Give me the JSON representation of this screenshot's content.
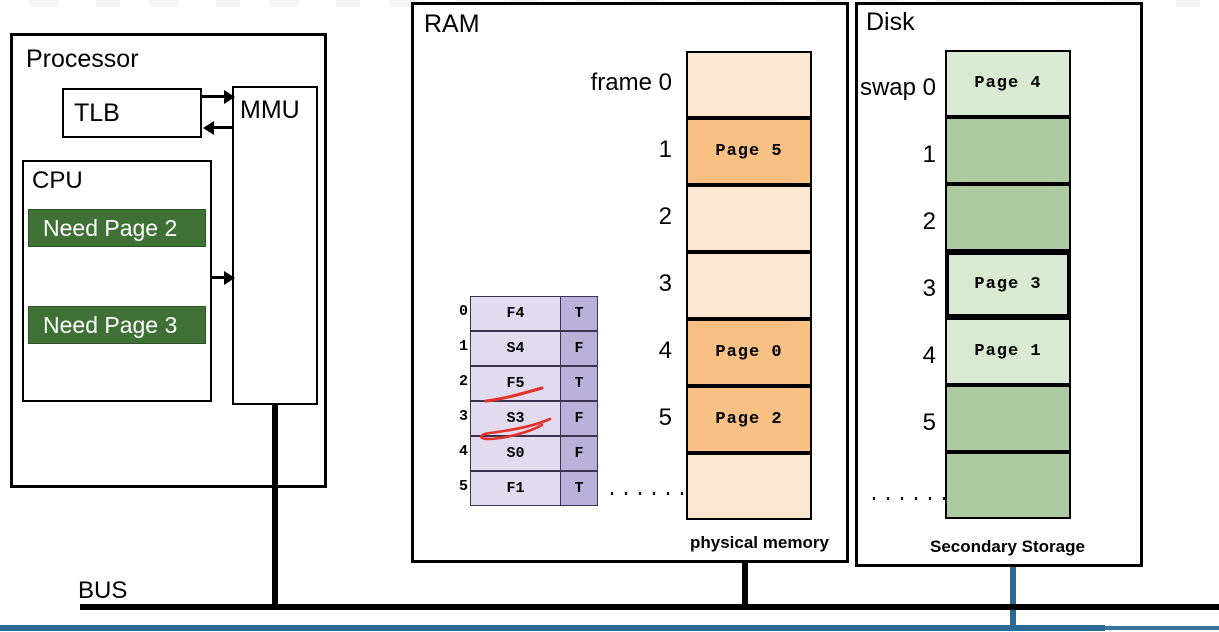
{
  "diagram": {
    "title_hidden_top_strip": "",
    "processor": {
      "label": "Processor",
      "tlb_label": "TLB",
      "mmu_label": "MMU",
      "cpu_label": "CPU",
      "requests": [
        "Need Page 2",
        "Need Page 3"
      ],
      "request_color": "#3f7036"
    },
    "ram": {
      "label": "RAM",
      "caption": "physical memory",
      "frame_label_prefix": "frame",
      "frame_labels": [
        "frame 0",
        "1",
        "2",
        "3",
        "4",
        "5"
      ],
      "ellipsis": "......",
      "frames": [
        {
          "index": "0",
          "content": "",
          "occupied": false
        },
        {
          "index": "1",
          "content": "Page  5",
          "occupied": true
        },
        {
          "index": "2",
          "content": "",
          "occupied": false
        },
        {
          "index": "3",
          "content": "",
          "occupied": false
        },
        {
          "index": "4",
          "content": "Page  0",
          "occupied": true
        },
        {
          "index": "5",
          "content": "Page  2",
          "occupied": true
        },
        {
          "index": "",
          "content": "",
          "occupied": false
        }
      ],
      "frame_empty_color": "#fce6cf",
      "frame_used_color": "#f8c183",
      "page_table": {
        "indices": [
          "0",
          "1",
          "2",
          "3",
          "4",
          "5"
        ],
        "location": [
          "F4",
          "S4",
          "F5",
          "S3",
          "S0",
          "F1"
        ],
        "valid": [
          "T",
          "F",
          "T",
          "F",
          "F",
          "T"
        ],
        "annotated_rows": [
          "2",
          "3"
        ],
        "annotation_color": "#e8302a",
        "col_value_color": "#e2dbf0",
        "col_flag_color": "#b9b1d9"
      }
    },
    "disk": {
      "label": "Disk",
      "caption": "Secondary Storage",
      "swap_labels": [
        "swap 0",
        "1",
        "2",
        "3",
        "4",
        "5"
      ],
      "ellipsis": "......",
      "slots": [
        {
          "index": "0",
          "content": "Page  4",
          "occupied": true,
          "highlight": false
        },
        {
          "index": "1",
          "content": "",
          "occupied": false,
          "highlight": false
        },
        {
          "index": "2",
          "content": "",
          "occupied": false,
          "highlight": false
        },
        {
          "index": "3",
          "content": "Page  3",
          "occupied": true,
          "highlight": true
        },
        {
          "index": "4",
          "content": "Page  1",
          "occupied": true,
          "highlight": false
        },
        {
          "index": "5",
          "content": "",
          "occupied": false,
          "highlight": false
        },
        {
          "index": "",
          "content": "",
          "occupied": false,
          "highlight": false
        }
      ],
      "slot_empty_color": "#aecaa0",
      "slot_used_color": "#d9e9d2"
    },
    "bus": {
      "label": "BUS",
      "color": "#000000",
      "underline_color": "#2e6a96"
    }
  }
}
